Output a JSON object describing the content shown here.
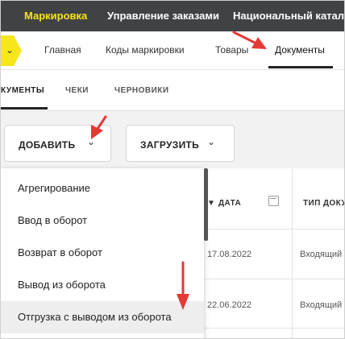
{
  "topnav": {
    "items": [
      "Маркировка",
      "Управление заказами",
      "Национальный каталог"
    ],
    "active_color": "#f7e61b"
  },
  "nav": {
    "menu_icon": "chevron-down-icon",
    "items": [
      "Главная",
      "Коды маркировки",
      "Товары",
      "Документы"
    ],
    "active_index": 3
  },
  "doc_tabs": {
    "items": [
      "КУМЕНТЫ",
      "ЧЕКИ",
      "ЧЕРНОВИКИ"
    ]
  },
  "toolbar": {
    "add_label": "ДОБАВИТЬ",
    "upload_label": "ЗАГРУЗИТЬ"
  },
  "table": {
    "col_date": "ДАТА",
    "col_type": "ТИП ДОКУ",
    "rows": [
      {
        "date": "17.08.2022",
        "type": "Входящий"
      },
      {
        "date": "22.06.2022",
        "type": "Входящий"
      }
    ]
  },
  "dropdown": {
    "items": [
      "Агрегирование",
      "Ввод в оборот",
      "Возврат в оборот",
      "Вывод из оборота",
      "Отгрузка с выводом из оборота"
    ],
    "hover_index": 4
  }
}
